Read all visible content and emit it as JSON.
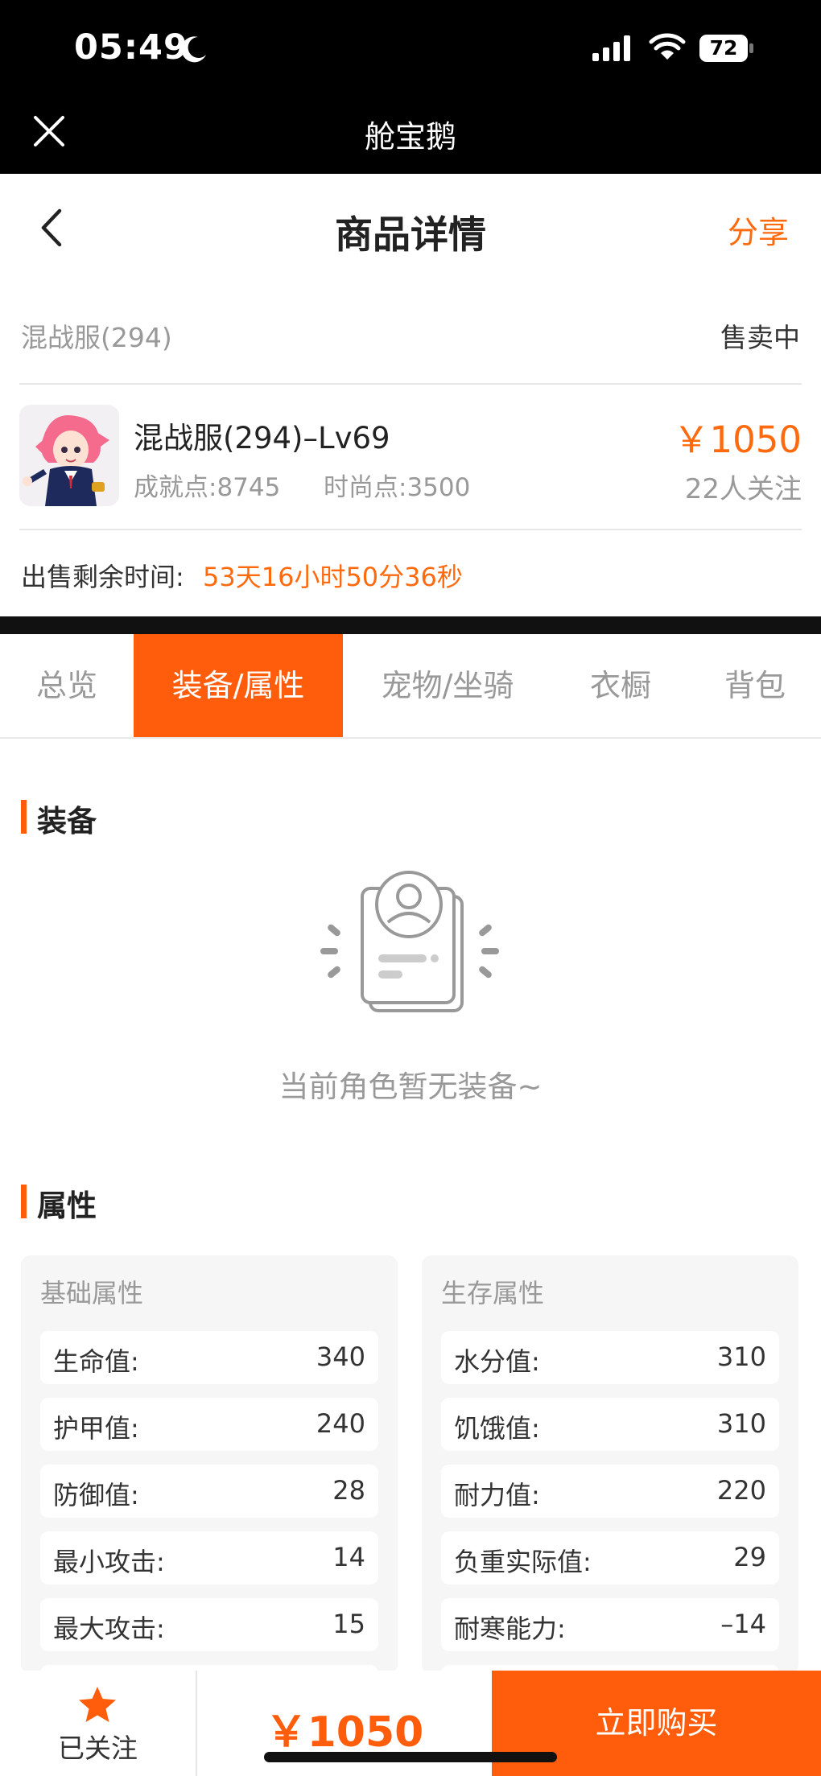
{
  "status_bar": {
    "time": "05:49",
    "battery": "72"
  },
  "app_bar": {
    "title": "舱宝鹅"
  },
  "header": {
    "title": "商品详情",
    "share": "分享"
  },
  "listing": {
    "server": "混战服(294)",
    "status": "售卖中",
    "name": "混战服(294)–Lv69",
    "achievement": "成就点:8745",
    "fashion": "时尚点:3500",
    "price": "￥1050",
    "followers": "22人关注",
    "remaining_label": "出售剩余时间:",
    "remaining_value": "53天16小时50分36秒"
  },
  "tabs": [
    {
      "label": "总览"
    },
    {
      "label": "装备/属性",
      "active": true
    },
    {
      "label": "宠物/坐骑"
    },
    {
      "label": "衣橱"
    },
    {
      "label": "背包"
    }
  ],
  "equipment": {
    "title": "装备",
    "empty_text": "当前角色暂无装备~"
  },
  "attributes": {
    "title": "属性",
    "basic": {
      "title": "基础属性",
      "rows": [
        {
          "k": "生命值:",
          "v": "340"
        },
        {
          "k": "护甲值:",
          "v": "240"
        },
        {
          "k": "防御值:",
          "v": "28"
        },
        {
          "k": "最小攻击:",
          "v": "14"
        },
        {
          "k": "最大攻击:",
          "v": "15"
        }
      ]
    },
    "survival": {
      "title": "生存属性",
      "rows": [
        {
          "k": "水分值:",
          "v": "310"
        },
        {
          "k": "饥饿值:",
          "v": "310"
        },
        {
          "k": "耐力值:",
          "v": "220"
        },
        {
          "k": "负重实际值:",
          "v": "29"
        },
        {
          "k": "耐寒能力:",
          "v": "–14"
        }
      ]
    }
  },
  "bottom_bar": {
    "follow_label": "已关注",
    "price": "￥1050",
    "buy_label": "立即购买"
  },
  "colors": {
    "accent": "#ff5c0b",
    "price": "#ff6a0f",
    "muted": "#999999"
  },
  "icons": [
    "moon-icon",
    "signal-icon",
    "wifi-icon",
    "battery-icon",
    "close-icon",
    "back-icon",
    "empty-equipment-icon",
    "star-icon"
  ]
}
